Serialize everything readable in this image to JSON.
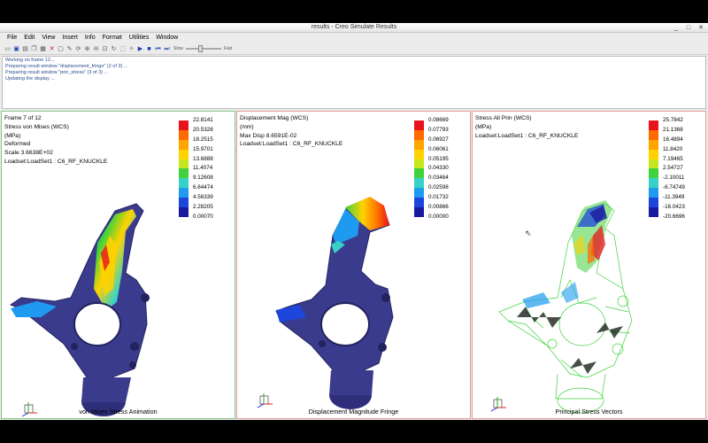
{
  "window": {
    "title": "results - Creo Simulate Results",
    "controls": [
      "_",
      "□",
      "✕"
    ]
  },
  "menubar": [
    "File",
    "Edit",
    "View",
    "Insert",
    "Info",
    "Format",
    "Utilities",
    "Window"
  ],
  "toolbar": {
    "icons": [
      "open-icon",
      "save-icon",
      "print-icon",
      "copy-icon",
      "paste-icon",
      "delete-icon",
      "new-icon",
      "edit-icon",
      "refresh-icon",
      "zoom-in-icon",
      "zoom-out-icon",
      "zoom-fit-icon",
      "rotate-icon",
      "select-icon",
      "animate-icon",
      "play-icon",
      "stop-icon",
      "step-back-icon",
      "step-forward-icon"
    ],
    "speed_slow": "Slow",
    "speed_fast": "Fast"
  },
  "messages": [
    "Working on frame 12...",
    "Preparing result window \"displacement_fringe\" (2 of 3) ...",
    "Preparing result window \"prin_stress\" (3 of 3) ...",
    "Updating the display ..."
  ],
  "colors": {
    "legend": [
      "#e8131c",
      "#ff6a00",
      "#ffa500",
      "#ffd200",
      "#c8e61e",
      "#3fd23c",
      "#36d2c8",
      "#1e9bf0",
      "#1e46dc",
      "#1a1a9e"
    ],
    "part": "#3b3b8e",
    "panel1_border": "#86c686",
    "panel2_border": "#e39a9a"
  },
  "panels": [
    {
      "info": [
        "Frame 7 of 12",
        "Stress von Mises (WCS)",
        "(MPa)",
        "Deformed",
        "Scale  3.6638E+02",
        "Loadset:LoadSet1 :  C6_RF_KNUCKLE"
      ],
      "legend_values": [
        "22.8141",
        "20.5328",
        "18.2515",
        "15.9701",
        "13.6888",
        "11.4074",
        "9.12608",
        "6.84474",
        "4.56339",
        "2.28205",
        "0.00070"
      ],
      "caption": "von Mises Stress Animation"
    },
    {
      "info": [
        "Displacement Mag (WCS)",
        "(mm)",
        "Max Disp  8.6591E-02",
        "Loadset:LoadSet1 :  C6_RF_KNUCKLE"
      ],
      "legend_values": [
        "0.08669",
        "0.07793",
        "0.06927",
        "0.06061",
        "0.05195",
        "0.04330",
        "0.03464",
        "0.02598",
        "0.01732",
        "0.00866",
        "0.00000"
      ],
      "caption": "Displacement Magnitude Fringe"
    },
    {
      "info": [
        "Stress All Prin (WCS)",
        "(MPa)",
        "Loadset:LoadSet1 :  C6_RF_KNUCKLE"
      ],
      "legend_values": [
        "25.7842",
        "21.1368",
        "16.4894",
        "11.8420",
        "7.19465",
        "2.54727",
        "-2.10011",
        "-6.74749",
        "-11.3949",
        "-16.0423",
        "-20.6696"
      ],
      "caption": "Principal Stress Vectors"
    }
  ]
}
